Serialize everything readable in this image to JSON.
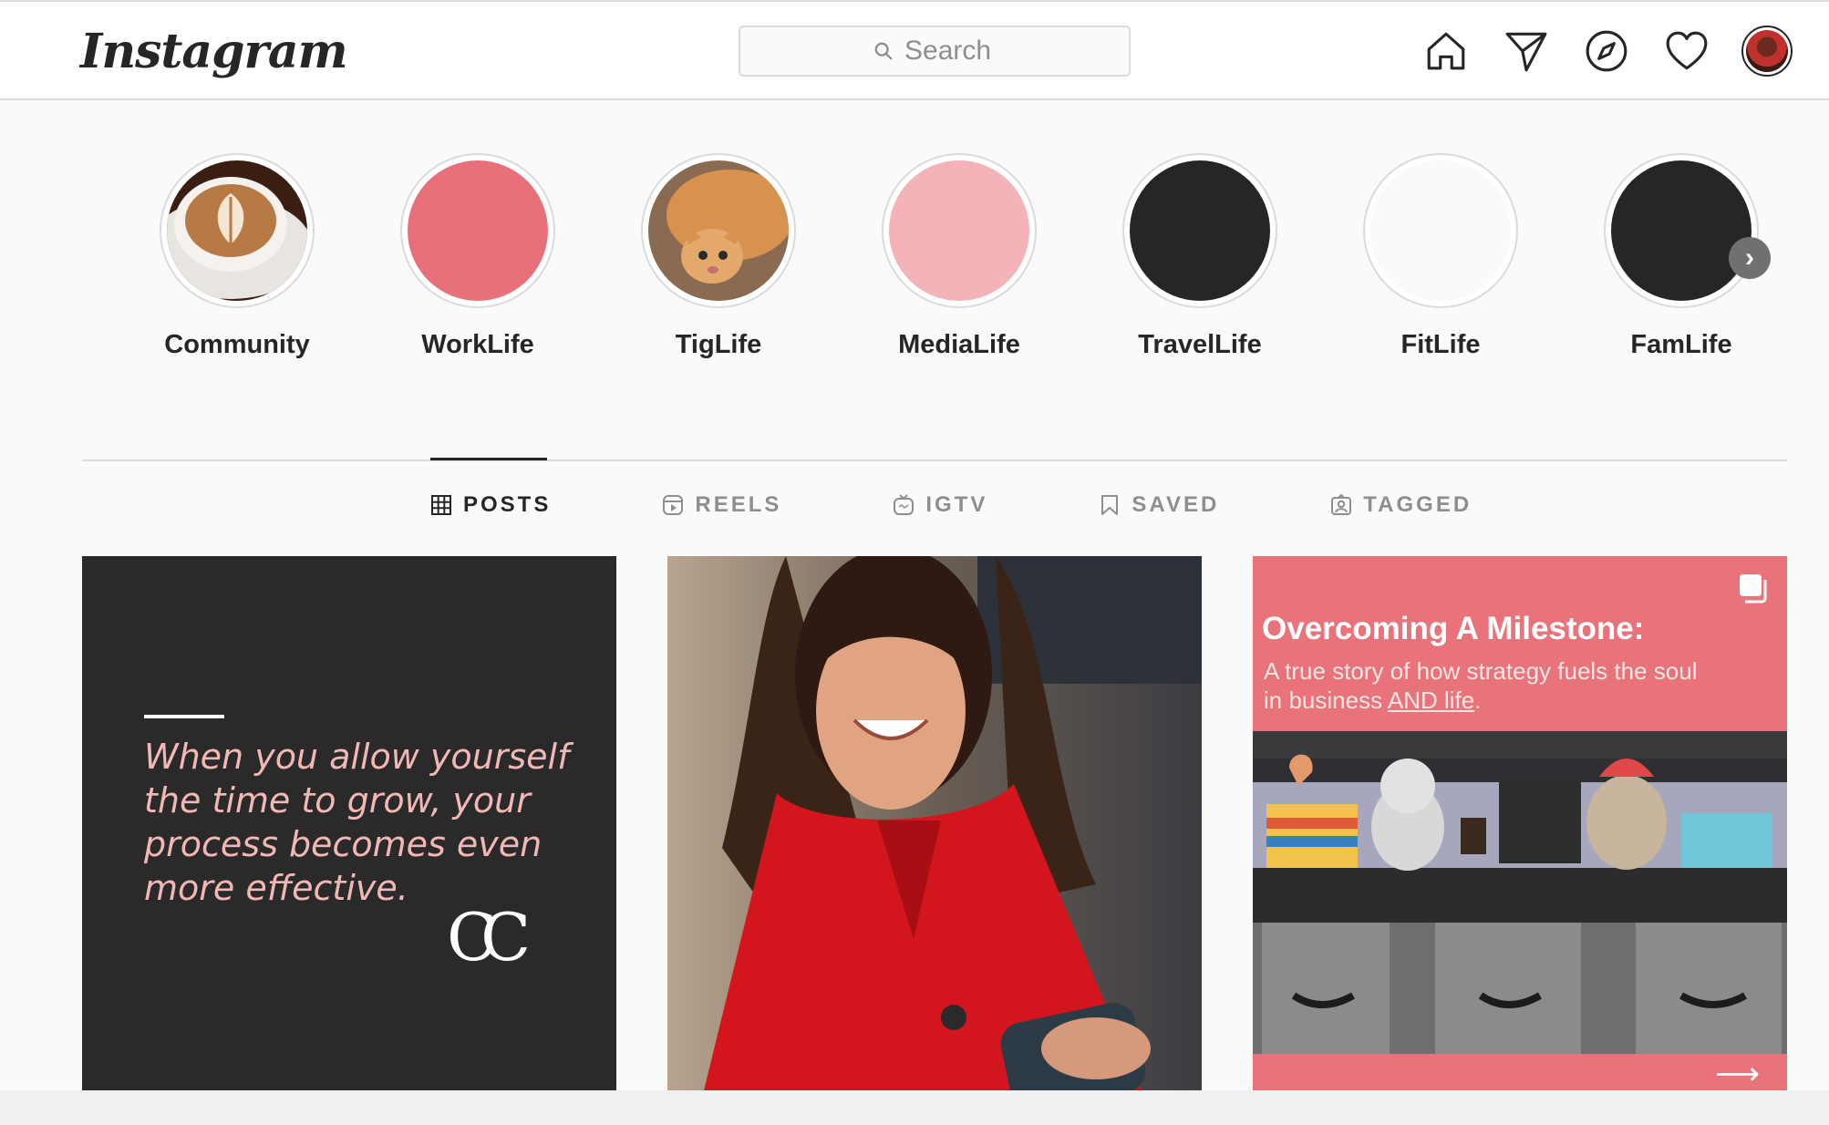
{
  "nav": {
    "logo": "Instagram",
    "search_placeholder": "Search",
    "icons": [
      "home-icon",
      "direct-icon",
      "explore-icon",
      "activity-icon",
      "profile-avatar"
    ]
  },
  "highlights": [
    {
      "label": "Community",
      "color": "#b98a5e",
      "image": "latte-art"
    },
    {
      "label": "WorkLife",
      "color": "#e8707a"
    },
    {
      "label": "TigLife",
      "color": "#c8864e",
      "image": "orange-cat"
    },
    {
      "label": "MediaLife",
      "color": "#f3b3b8"
    },
    {
      "label": "TravelLife",
      "color": "#262626"
    },
    {
      "label": "FitLife",
      "color": "#f8fafb"
    },
    {
      "label": "FamLife",
      "color": "#262626"
    }
  ],
  "tabs": [
    {
      "label": "POSTS",
      "active": true,
      "icon": "grid-icon"
    },
    {
      "label": "REELS",
      "active": false,
      "icon": "reels-icon"
    },
    {
      "label": "IGTV",
      "active": false,
      "icon": "igtv-icon"
    },
    {
      "label": "SAVED",
      "active": false,
      "icon": "bookmark-icon"
    },
    {
      "label": "TAGGED",
      "active": false,
      "icon": "tagged-icon"
    }
  ],
  "posts": [
    {
      "quote": "When you allow yourself the time to grow, your process becomes even more effective.",
      "monogram": "CC",
      "bg": "#2b2a2a"
    },
    {
      "image": "woman-in-red-coat-with-phone"
    },
    {
      "title": "Overcoming A Milestone:",
      "subtitle_start": "A true story of how strategy fuels the soul in business ",
      "subtitle_link": "AND life",
      "subtitle_end": ".",
      "arrow": "⟶",
      "bg": "#e8737b"
    }
  ]
}
